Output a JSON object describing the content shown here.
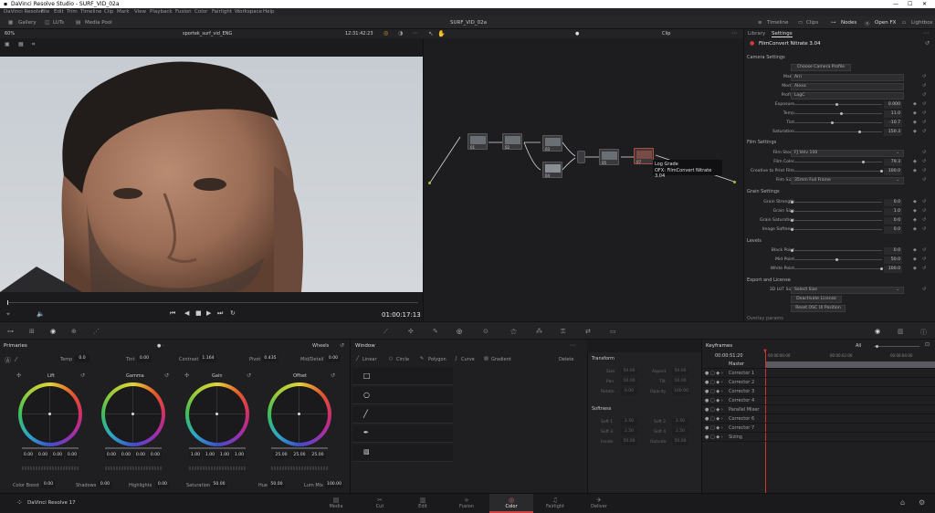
{
  "window": {
    "title": "DaVinci Resolve Studio - SURF_VID_02a"
  },
  "menu": [
    "DaVinci Resolve",
    "File",
    "Edit",
    "Trim",
    "Timeline",
    "Clip",
    "Mark",
    "View",
    "Playback",
    "Fusion",
    "Color",
    "Fairlight",
    "Workspace",
    "Help"
  ],
  "toolbar": {
    "gallery": "Gallery",
    "luts": "LUTs",
    "media_pool": "Media Pool",
    "project_title": "SURF_VID_02a",
    "timeline": "Timeline",
    "clips": "Clips",
    "nodes": "Nodes",
    "open_fx": "Open FX",
    "lightbox": "Lightbox"
  },
  "viewer": {
    "zoom": "60%",
    "clip_name": "sportek_surf_vid_ENG",
    "timecode": "12:31:42:23",
    "current_tc": "01:00:17:13",
    "mode": "Clip"
  },
  "nodes": {
    "labels": [
      "01",
      "02",
      "03",
      "04",
      "05",
      "06",
      "07"
    ],
    "tooltip_line1": "Log Grade",
    "tooltip_line2": "OFX: FilmConvert Nitrate 3.04"
  },
  "settings": {
    "tab_library": "Library",
    "tab_settings": "Settings",
    "plugin": "FilmConvert Nitrate 3.04",
    "camera_settings": "Camera Settings",
    "choose_profile": "Choose Camera Profile",
    "make_label": "Make",
    "make_value": "Arri",
    "model_label": "Model",
    "model_value": "Alexa",
    "profile_label": "Profile",
    "profile_value": "LogC",
    "exposure_label": "Exposure",
    "exposure_value": "0.000",
    "temp_label": "Temp",
    "temp_value": "11.0",
    "tint_label": "Tint",
    "tint_value": "-10.7",
    "saturation_label": "Saturation",
    "saturation_value": "150.3",
    "film_settings": "Film Settings",
    "film_stock_label": "Film Stock",
    "film_stock_value": "FJ Velv 100",
    "film_color_label": "Film Color",
    "film_color_value": "79.3",
    "creative_label": "Creative to Print Film",
    "creative_value": "100.0",
    "film_size_label": "Film Size",
    "film_size_value": "35mm Full Frame",
    "grain_settings": "Grain Settings",
    "grain_strength_label": "Grain Strength",
    "grain_strength_value": "0.0",
    "grain_size_label": "Grain Size",
    "grain_size_value": "1.0",
    "grain_sat_label": "Grain Saturation",
    "grain_sat_value": "0.0",
    "image_soft_label": "Image Softness",
    "image_soft_value": "0.0",
    "levels": "Levels",
    "black_label": "Black Point",
    "black_value": "0.0",
    "mid_label": "Mid Point",
    "mid_value": "50.0",
    "white_label": "White Point",
    "white_value": "100.0",
    "export_license": "Export and License",
    "lut_size_label": "3D LUT Size",
    "lut_size_value": "Select Size",
    "deactivate": "Deactivate License",
    "reset_osc": "Reset OSC UI Position",
    "overlay_params": "Overlay params"
  },
  "primaries": {
    "title": "Primaries",
    "mode": "Wheels",
    "temp_label": "Temp",
    "temp_value": "0.0",
    "tint_label": "Tint",
    "tint_value": "0.00",
    "contrast_label": "Contrast",
    "contrast_value": "1.164",
    "pivot_label": "Pivot",
    "pivot_value": "0.435",
    "middetail_label": "Mid/Detail",
    "middetail_value": "0.00",
    "wheels": [
      {
        "name": "Lift",
        "values": [
          "0.00",
          "0.00",
          "0.00",
          "0.00"
        ]
      },
      {
        "name": "Gamma",
        "values": [
          "0.00",
          "0.00",
          "0.00",
          "0.00"
        ]
      },
      {
        "name": "Gain",
        "values": [
          "1.00",
          "1.00",
          "1.00",
          "1.00"
        ]
      },
      {
        "name": "Offset",
        "values": [
          "25.00",
          "25.00",
          "25.00"
        ]
      }
    ],
    "color_boost_label": "Color Boost",
    "color_boost_value": "0.00",
    "shadows_label": "Shadows",
    "shadows_value": "0.00",
    "highlights_label": "Highlights",
    "highlights_value": "0.00",
    "saturation_label": "Saturation",
    "saturation_value": "50.00",
    "hue_label": "Hue",
    "hue_value": "50.00",
    "lummix_label": "Lum Mix",
    "lummix_value": "100.00"
  },
  "window_panel": {
    "title": "Window",
    "linear": "Linear",
    "circle": "Circle",
    "polygon": "Polygon",
    "curve": "Curve",
    "gradient": "Gradient",
    "delete": "Delete"
  },
  "transform": {
    "title": "Transform",
    "size": "Size",
    "size_v": "50.00",
    "aspect": "Aspect",
    "aspect_v": "50.00",
    "pan": "Pan",
    "pan_v": "50.00",
    "tilt": "Tilt",
    "tilt_v": "50.00",
    "rotate": "Rotate",
    "rotate_v": "0.00",
    "opacity": "Opacity",
    "opacity_v": "100.00",
    "softness": "Softness",
    "soft1": "Soft 1",
    "soft1_v": "2.50",
    "soft2": "Soft 2",
    "soft2_v": "2.50",
    "soft3": "Soft 3",
    "soft3_v": "2.50",
    "soft4": "Soft 4",
    "soft4_v": "2.50",
    "inside": "Inside",
    "inside_v": "50.00",
    "outside": "Outside",
    "outside_v": "50.00"
  },
  "keyframes": {
    "title": "Keyframes",
    "filter": "All",
    "timecode": "00:00:51:20",
    "t1": "00:00:00:00",
    "t2": "00:00:02:00",
    "t3": "00:00:04:00",
    "rows": [
      "Master",
      "Corrector 1",
      "Corrector 2",
      "Corrector 3",
      "Corrector 4",
      "Parallel Mixer",
      "Corrector 6",
      "Corrector 7",
      "Sizing"
    ]
  },
  "pages": [
    "Media",
    "Cut",
    "Edit",
    "Fusion",
    "Color",
    "Fairlight",
    "Deliver"
  ],
  "app_name": "DaVinci Resolve 17"
}
